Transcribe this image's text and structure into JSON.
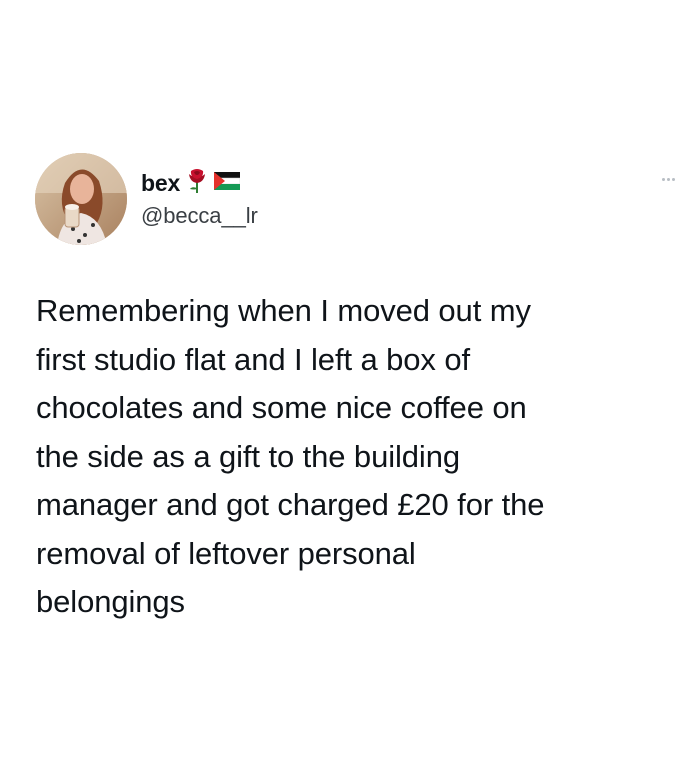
{
  "tweet": {
    "display_name": "bex",
    "handle": "@becca__lr",
    "name_icons": [
      "rose-icon",
      "palestine-flag-icon"
    ],
    "text": "Remembering when I moved out my\nfirst studio flat and I left a box of\nchocolates and some nice coffee on\nthe side as a gift to the building\nmanager and got charged £20 for the\nremoval of leftover personal\nbelongings"
  },
  "colors": {
    "text": "#0f1419",
    "handle": "#3a3f44",
    "more_dots": "#b8bec4",
    "rose": "#c8102e",
    "flag_green": "#149954",
    "flag_red": "#e4312b"
  }
}
